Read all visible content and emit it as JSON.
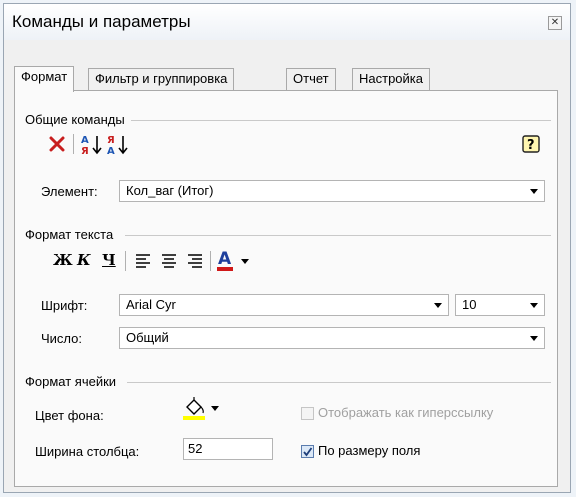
{
  "window": {
    "title": "Команды и параметры"
  },
  "tabs": [
    "Формат",
    "Фильтр и группировка",
    "Отчет",
    "Настройка"
  ],
  "general": {
    "title": "Общие команды",
    "element_label": "Элемент:",
    "element_value": "Кол_ваг (Итог)"
  },
  "text_format": {
    "title": "Формат текста",
    "bold": "Ж",
    "italic": "К",
    "underline": "Ч",
    "font_label": "Шрифт:",
    "font_value": "Arial Cyr",
    "size_value": "10",
    "number_label": "Число:",
    "number_value": "Общий",
    "font_color": "#d01818"
  },
  "cell_format": {
    "title": "Формат ячейки",
    "bg_color_label": "Цвет фона:",
    "bg_color": "#ffff00",
    "hyperlink_label": "Отображать как гиперссылку",
    "hyperlink_checked": false,
    "width_label": "Ширина столбца:",
    "width_value": "52",
    "autofit_label": "По размеру поля",
    "autofit_checked": true
  }
}
